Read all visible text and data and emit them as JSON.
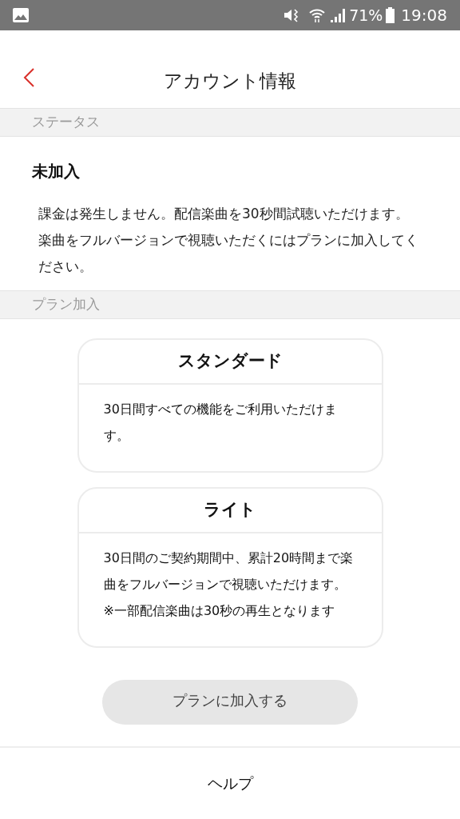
{
  "status_bar": {
    "battery": "71%",
    "time": "19:08"
  },
  "header": {
    "title": "アカウント情報"
  },
  "status_section": {
    "heading": "ステータス",
    "status": "未加入",
    "description": "課金は発生しません。配信楽曲を30秒間試聴いただけます。楽曲をフルバージョンで視聴いただくにはプランに加入してください。"
  },
  "plan_section": {
    "heading": "プラン加入",
    "plans": [
      {
        "name": "スタンダード",
        "description": [
          "30日間すべての機能をご利用いただけます。"
        ]
      },
      {
        "name": "ライト",
        "description": [
          "30日間のご契約期間中、累計20時間まで楽曲をフルバージョンで視聴いただけます。",
          "※一部配信楽曲は30秒の再生となります"
        ]
      }
    ],
    "button": "プランに加入する"
  },
  "footer": {
    "help": "ヘルプ"
  }
}
